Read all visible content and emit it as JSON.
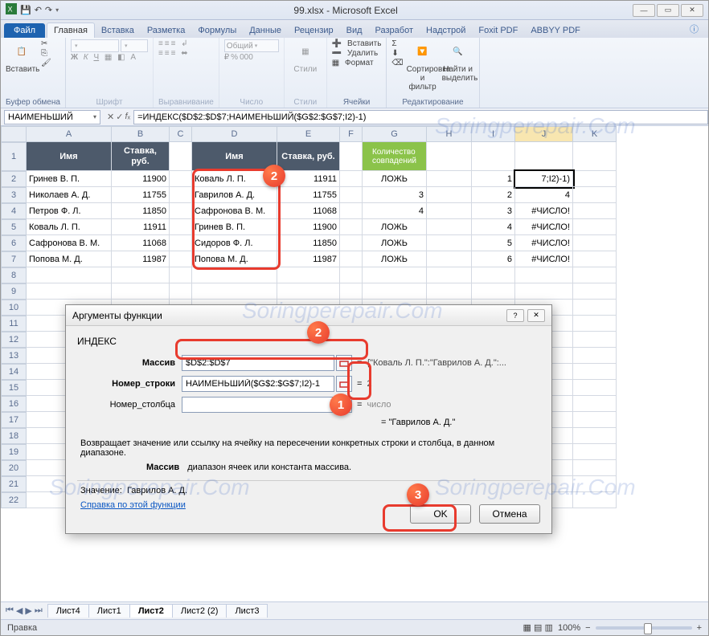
{
  "title": "99.xlsx - Microsoft Excel",
  "tabs": {
    "file": "Файл",
    "home": "Главная",
    "insert": "Вставка",
    "layout": "Разметка",
    "formulas": "Формулы",
    "data": "Данные",
    "review": "Рецензир",
    "view": "Вид",
    "developer": "Разработ",
    "addins": "Надстрой",
    "foxit": "Foxit PDF",
    "abbyy": "ABBYY PDF"
  },
  "ribbon": {
    "paste": "Вставить",
    "clipboard": "Буфер обмена",
    "font": "Шрифт",
    "align": "Выравнивание",
    "number": "Число",
    "numfmt": "Общий",
    "styles": "Стили",
    "cells": "Ячейки",
    "insert": "Вставить",
    "delete": "Удалить",
    "format": "Формат",
    "editing": "Редактирование",
    "sort": "Сортировка\nи фильтр",
    "find": "Найти и\nвыделить"
  },
  "namebox": "НАИМЕНЬШИЙ",
  "formula": "=ИНДЕКС($D$2:$D$7;НАИМЕНЬШИЙ($G$2:$G$7;I2)-1)",
  "cols": [
    "A",
    "B",
    "C",
    "D",
    "E",
    "F",
    "G",
    "H",
    "I",
    "J",
    "K"
  ],
  "rownums": [
    "1",
    "2",
    "3",
    "4",
    "5",
    "6",
    "7",
    "8",
    "9",
    "10",
    "11",
    "12",
    "13",
    "14",
    "15",
    "16",
    "17",
    "18",
    "19",
    "20",
    "21",
    "22"
  ],
  "headers1": {
    "A": "Имя",
    "B": "Ставка,\nруб.",
    "D": "Имя",
    "E": "Ставка, руб.",
    "G": "Количество\nсовпадений"
  },
  "tableA": [
    "Гринев В. П.",
    "Николаев А. Д.",
    "Петров Ф. Л.",
    "Коваль Л. П.",
    "Сафронова В. М.",
    "Попова М. Д."
  ],
  "tableB": [
    "11900",
    "11755",
    "11850",
    "11911",
    "11068",
    "11987"
  ],
  "tableD": [
    "Коваль Л. П.",
    "Гаврилов А. Д.",
    "Сафронова В. М.",
    "Гринев В. П.",
    "Сидоров Ф. Л.",
    "Попова М. Д."
  ],
  "tableE": [
    "11911",
    "11755",
    "11068",
    "11900",
    "11850",
    "11987"
  ],
  "tableG": [
    "ЛОЖЬ",
    "3",
    "4",
    "ЛОЖЬ",
    "ЛОЖЬ",
    "ЛОЖЬ"
  ],
  "tableH": [
    "",
    "",
    "",
    "",
    "",
    ""
  ],
  "tableI": [
    "1",
    "2",
    "3",
    "4",
    "5",
    "6"
  ],
  "tableJ": [
    "7;I2)-1)",
    "4",
    "#ЧИСЛО!",
    "#ЧИСЛО!",
    "#ЧИСЛО!",
    "#ЧИСЛО!"
  ],
  "dialog": {
    "title": "Аргументы функции",
    "fn": "ИНДЕКС",
    "arg1_label": "Массив",
    "arg1_val": "$D$2:$D$7",
    "arg1_prev": "{\"Коваль Л. П.\":\"Гаврилов А. Д.\":...",
    "arg2_label": "Номер_строки",
    "arg2_val": "НАИМЕНЬШИЙ($G$2:$G$7;I2)-1",
    "arg2_prev": "2",
    "arg3_label": "Номер_столбца",
    "arg3_val": "",
    "arg3_prev": "число",
    "result1": "\"Гаврилов А. Д.\"",
    "desc": "Возвращает значение или ссылку на ячейку на пересечении конкретных строки и столбца, в данном диапазоне.",
    "argdesc_b": "Массив",
    "argdesc": "диапазон ячеек или константа массива.",
    "res_lbl": "Значение:",
    "res_val": "Гаврилов А. Д.",
    "help": "Справка по этой функции",
    "ok": "OK",
    "cancel": "Отмена"
  },
  "sheets": [
    "Лист4",
    "Лист1",
    "Лист2",
    "Лист2 (2)",
    "Лист3"
  ],
  "status": {
    "left": "Правка",
    "zoom": "100%"
  },
  "chart_data": {
    "type": "table",
    "tables": [
      {
        "columns": [
          "Имя",
          "Ставка, руб."
        ],
        "rows": [
          [
            "Гринев В. П.",
            11900
          ],
          [
            "Николаев А. Д.",
            11755
          ],
          [
            "Петров Ф. Л.",
            11850
          ],
          [
            "Коваль Л. П.",
            11911
          ],
          [
            "Сафронова В. М.",
            11068
          ],
          [
            "Попова М. Д.",
            11987
          ]
        ]
      },
      {
        "columns": [
          "Имя",
          "Ставка, руб."
        ],
        "rows": [
          [
            "Коваль Л. П.",
            11911
          ],
          [
            "Гаврилов А. Д.",
            11755
          ],
          [
            "Сафронова В. М.",
            11068
          ],
          [
            "Гринев В. П.",
            11900
          ],
          [
            "Сидоров Ф. Л.",
            11850
          ],
          [
            "Попова М. Д.",
            11987
          ]
        ]
      }
    ]
  }
}
